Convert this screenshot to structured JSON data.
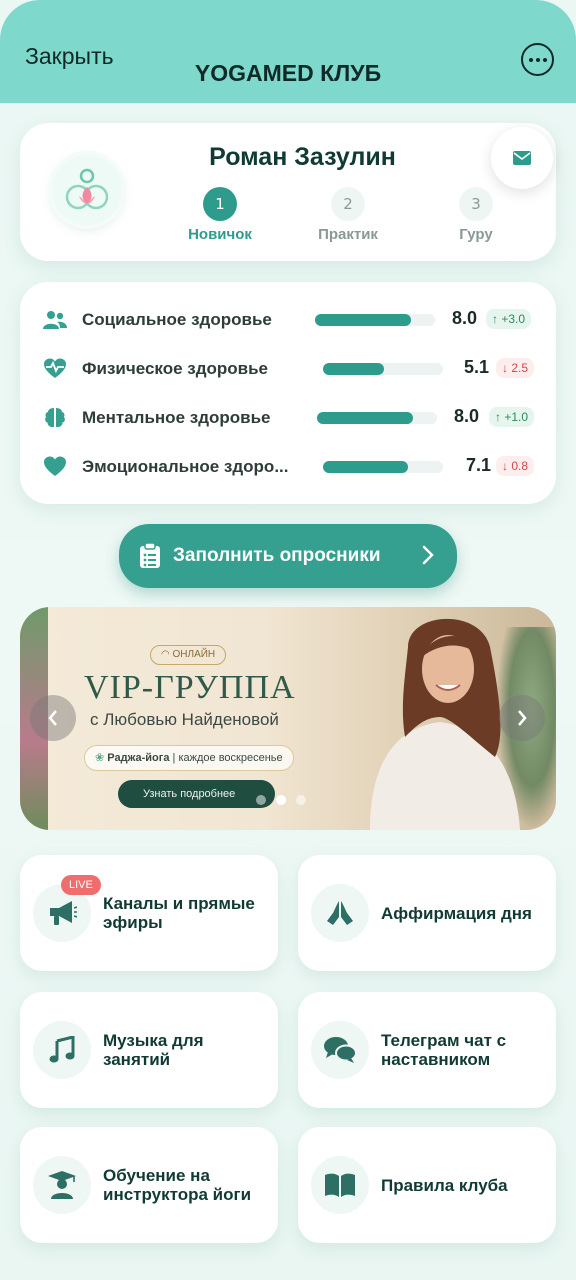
{
  "header": {
    "close_label": "Закрыть",
    "title": "YOGAMED КЛУБ"
  },
  "profile": {
    "name": "Роман Зазулин",
    "levels": [
      {
        "num": "1",
        "label": "Новичок",
        "active": true
      },
      {
        "num": "2",
        "label": "Практик",
        "active": false
      },
      {
        "num": "3",
        "label": "Гуру",
        "active": false
      }
    ]
  },
  "health": [
    {
      "icon": "people-icon",
      "label": "Социальное здоровье",
      "score": "8.0",
      "progress": 0.8,
      "delta": "↑ +3.0",
      "trend": "up"
    },
    {
      "icon": "heartbeat-icon",
      "label": "Физическое здоровье",
      "score": "5.1",
      "progress": 0.51,
      "delta": "↓ 2.5",
      "trend": "down"
    },
    {
      "icon": "brain-icon",
      "label": "Ментальное здоровье",
      "score": "8.0",
      "progress": 0.8,
      "delta": "↑ +1.0",
      "trend": "up"
    },
    {
      "icon": "heart-icon",
      "label": "Эмоциональное здоро...",
      "score": "7.1",
      "progress": 0.71,
      "delta": "↓ 0.8",
      "trend": "down"
    }
  ],
  "survey_button": {
    "label": "Заполнить опросники"
  },
  "banner": {
    "badge": "ОНЛАЙН",
    "title": "VIP-ГРУППА",
    "subtitle": "с Любовью Найденовой",
    "pill_left": "Раджа-йога",
    "pill_right": "каждое воскресенье",
    "cta": "Узнать подробнее",
    "slide_index": 1,
    "slide_count": 3
  },
  "tiles": [
    {
      "icon": "megaphone-icon",
      "label": "Каналы и прямые эфиры",
      "badge": "LIVE"
    },
    {
      "icon": "praying-hands-icon",
      "label": "Аффирмация дня"
    },
    {
      "icon": "music-note-icon",
      "label": "Музыка для занятий"
    },
    {
      "icon": "chat-bubbles-icon",
      "label": "Телеграм чат с наставником"
    },
    {
      "icon": "graduate-icon",
      "label": "Обучение на инструктора йоги"
    },
    {
      "icon": "book-icon",
      "label": "Правила клуба"
    }
  ],
  "colors": {
    "accent": "#2e9c8c",
    "header": "#7fd8cc",
    "up": "#2f8a57",
    "down": "#d04a4a"
  }
}
